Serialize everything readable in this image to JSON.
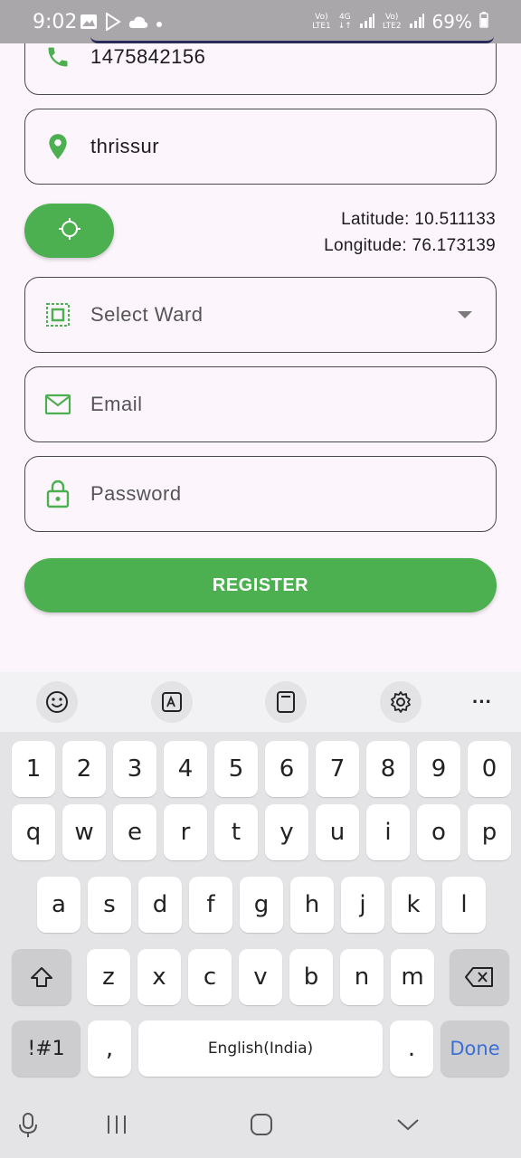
{
  "status_bar": {
    "time": "9:02",
    "battery": "69%",
    "sim1_tag_top": "Vo)",
    "sim1_tag_bottom": "LTE1",
    "net_type": "4G",
    "sim2_tag_top": "Vo)",
    "sim2_tag_bottom": "LTE2"
  },
  "form": {
    "phone_value": "1475842156",
    "place_value": "thrissur",
    "latitude_text": "Latitude: 10.511133",
    "longitude_text": "Longitude: 76.173139",
    "ward_placeholder": "Select Ward",
    "email_placeholder": "Email",
    "password_placeholder": "Password",
    "register_label": "REGISTER"
  },
  "colors": {
    "accent_green": "#4caf50",
    "background": "#fcf5fc",
    "done_blue": "#3b6fd6"
  },
  "icons": {
    "phone": "phone-icon",
    "place": "location-pin-icon",
    "locate": "gps-crosshair-icon",
    "ward": "select-area-icon",
    "email": "mail-icon",
    "password": "lock-icon"
  },
  "keyboard": {
    "toolbar": [
      "emoji-icon",
      "translate-icon",
      "clipboard-icon",
      "settings-icon",
      "more-icon"
    ],
    "more_label": "···",
    "row_numbers": [
      "1",
      "2",
      "3",
      "4",
      "5",
      "6",
      "7",
      "8",
      "9",
      "0"
    ],
    "row_top": [
      "q",
      "w",
      "e",
      "r",
      "t",
      "y",
      "u",
      "i",
      "o",
      "p"
    ],
    "row_middle": [
      "a",
      "s",
      "d",
      "f",
      "g",
      "h",
      "j",
      "k",
      "l"
    ],
    "row_bottom": [
      "z",
      "x",
      "c",
      "v",
      "b",
      "n",
      "m"
    ],
    "symbols_label": "!#1",
    "comma_label": ",",
    "space_label": "English(India)",
    "period_label": ".",
    "done_label": "Done"
  }
}
